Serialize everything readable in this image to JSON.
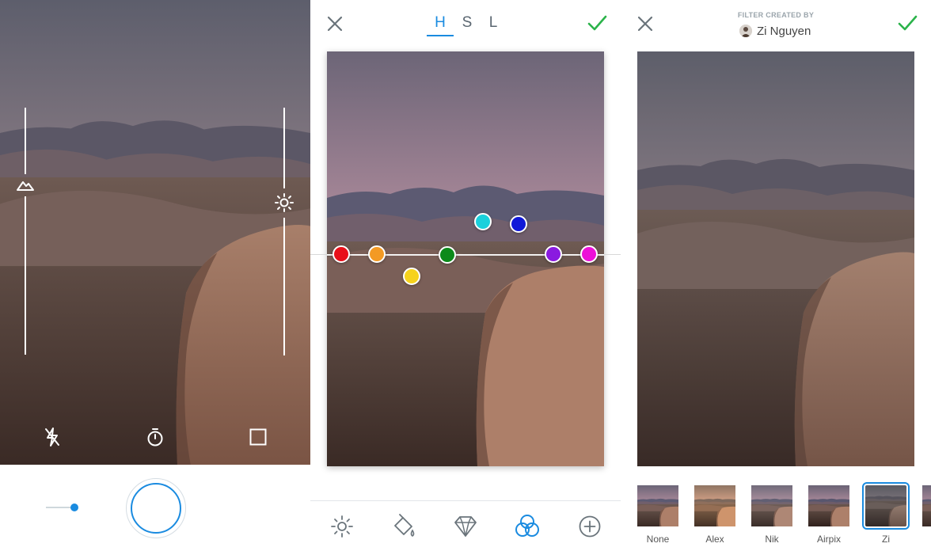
{
  "hsl_tabs": [
    {
      "label": "H",
      "active": true
    },
    {
      "label": "S",
      "active": false
    },
    {
      "label": "L",
      "active": false
    }
  ],
  "hsl_dots": [
    {
      "name": "red",
      "color": "#e8101a"
    },
    {
      "name": "orange",
      "color": "#f39a24"
    },
    {
      "name": "yellow",
      "color": "#f6d21c"
    },
    {
      "name": "green",
      "color": "#0c8a1a"
    },
    {
      "name": "cyan",
      "color": "#1ad0dc"
    },
    {
      "name": "blue",
      "color": "#1018d8"
    },
    {
      "name": "purple",
      "color": "#8a1ae0"
    },
    {
      "name": "magenta",
      "color": "#ec10d8"
    }
  ],
  "filter_panel": {
    "creator_label": "FILTER CREATED BY",
    "creator_name": "Zi Nguyen"
  },
  "filters": [
    {
      "label": "None",
      "selected": false
    },
    {
      "label": "Alex",
      "selected": false
    },
    {
      "label": "Nik",
      "selected": false
    },
    {
      "label": "Airpix",
      "selected": false
    },
    {
      "label": "Zi",
      "selected": true
    },
    {
      "label": "",
      "selected": false
    }
  ],
  "colors": {
    "accent": "#1a8be0",
    "confirm": "#2bb34a"
  }
}
